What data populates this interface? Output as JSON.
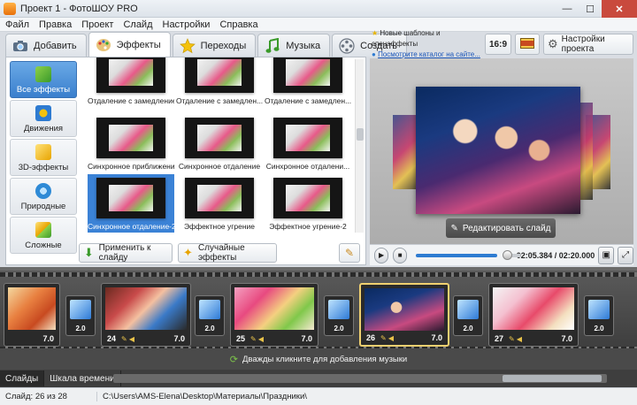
{
  "window": {
    "title": "Проект 1 - ФотоШОУ PRO"
  },
  "menu": [
    "Файл",
    "Правка",
    "Проект",
    "Слайд",
    "Настройки",
    "Справка"
  ],
  "tabs": [
    {
      "label": "Добавить",
      "icon": "camera-icon"
    },
    {
      "label": "Эффекты",
      "icon": "palette-icon"
    },
    {
      "label": "Переходы",
      "icon": "star-icon"
    },
    {
      "label": "Музыка",
      "icon": "music-note-icon"
    },
    {
      "label": "Создать",
      "icon": "film-reel-icon"
    }
  ],
  "categories": [
    {
      "label": "Все эффекты"
    },
    {
      "label": "Движения"
    },
    {
      "label": "3D-эффекты"
    },
    {
      "label": "Природные"
    },
    {
      "label": "Сложные"
    }
  ],
  "effects": [
    {
      "label": "Отдаление с замедлением"
    },
    {
      "label": "Отдаление с замедлен..."
    },
    {
      "label": "Отдаление с замедлен..."
    },
    {
      "label": "Синхронное приближение"
    },
    {
      "label": "Синхронное отдаление"
    },
    {
      "label": "Синхронное отдалени..."
    },
    {
      "label": "Синхронное отдаление-2"
    },
    {
      "label": "Эффектное угрение"
    },
    {
      "label": "Эффектное угрение-2"
    }
  ],
  "buttons": {
    "apply": "Применить к слайду",
    "random": "Случайные эффекты",
    "edit_slide": "Редактировать слайд",
    "ratio": "16:9",
    "settings": "Настройки проекта"
  },
  "news": {
    "line1": "Новые шаблоны и спецэффекты",
    "line2": "Посмотрите каталог на сайте..."
  },
  "player": {
    "time": "02:05.384 / 02:20.000",
    "progress": 0.88
  },
  "timeline": {
    "slides": [
      {
        "number": "",
        "duration": "7.0"
      },
      {
        "number": "24",
        "duration": "7.0"
      },
      {
        "number": "25",
        "duration": "7.0"
      },
      {
        "number": "26",
        "duration": "7.0"
      },
      {
        "number": "27",
        "duration": "7.0"
      }
    ],
    "transitions": [
      "2.0",
      "2.0",
      "2.0",
      "2.0",
      "2.0"
    ],
    "selected_slide": "26"
  },
  "music_hint": "Дважды кликните для добавления музыки",
  "bottom_tabs": [
    "Слайды",
    "Шкала времени"
  ],
  "status": {
    "slide": "Слайд: 26 из 28",
    "path": "C:\\Users\\AMS-Elena\\Desktop\\Материалы\\Праздники\\"
  },
  "colors": {
    "accent": "#3b82d6",
    "selected_slide_border": "#f0d070"
  }
}
